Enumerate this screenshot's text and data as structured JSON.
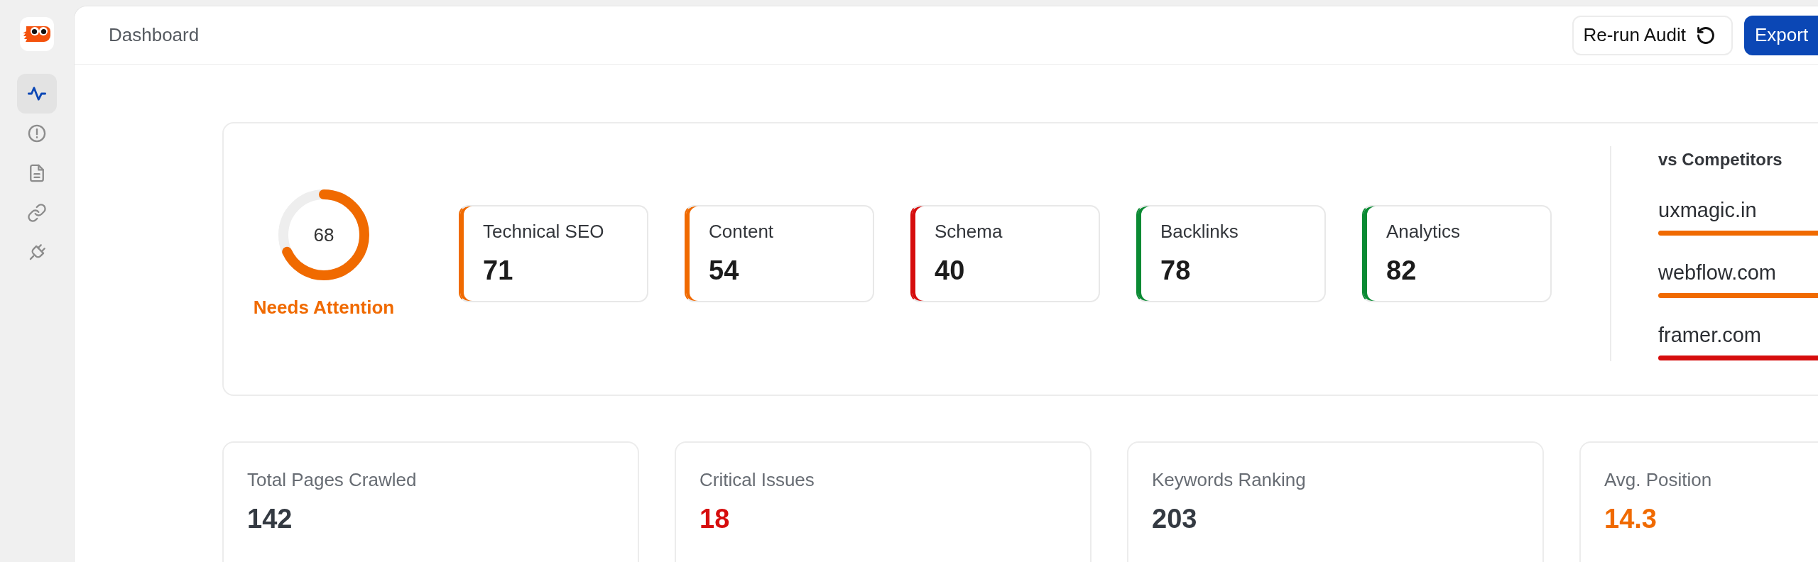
{
  "sidebar": {
    "items": [
      {
        "selected": true
      },
      {
        "selected": false
      },
      {
        "selected": false
      },
      {
        "selected": false
      },
      {
        "selected": false
      }
    ]
  },
  "header": {
    "title": "Dashboard",
    "buttons": [
      {
        "label": "Re-run Audit",
        "kind": "secondary"
      },
      {
        "label": "Export",
        "kind": "primary"
      }
    ]
  },
  "score": {
    "value": "68",
    "level": 0.68,
    "status": "Needs Attention"
  },
  "categories": [
    {
      "label": "Technical SEO",
      "value": "71",
      "color": "#f06a00"
    },
    {
      "label": "Content",
      "value": "54",
      "color": "#f06a00"
    },
    {
      "label": "Schema",
      "value": "40",
      "color": "#d60d0d"
    },
    {
      "label": "Backlinks",
      "value": "78",
      "color": "#0a8a33"
    },
    {
      "label": "Analytics",
      "value": "82",
      "color": "#0a8a33"
    }
  ],
  "competitors": {
    "title": "vs Competitors",
    "items": [
      {
        "name": "uxmagic.in",
        "color": "#f06a00"
      },
      {
        "name": "webflow.com",
        "color": "#f06a00"
      },
      {
        "name": "framer.com",
        "color": "#d60d0d"
      }
    ]
  },
  "stats": [
    {
      "label": "Total Pages Crawled",
      "value": "142",
      "color": "#343a42"
    },
    {
      "label": "Critical Issues",
      "value": "18",
      "color": "#d60d0d"
    },
    {
      "label": "Keywords Ranking",
      "value": "203",
      "color": "#343a42"
    },
    {
      "label": "Avg. Position",
      "value": "14.3",
      "color": "#f06a00"
    }
  ]
}
